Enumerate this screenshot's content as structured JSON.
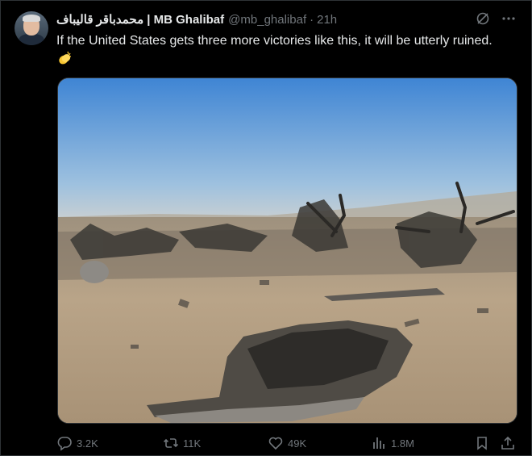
{
  "tweet": {
    "author_name": "محمدباقر قالیباف | MB Ghalibaf",
    "handle": "@mb_ghalibaf",
    "time": "21h",
    "text": "If the United States gets three more victories like this, it will be utterly ruined.",
    "emoji_icon": "clapping-hands-emoji"
  },
  "actions": {
    "replies": "3.2K",
    "reposts": "11K",
    "likes": "49K",
    "views": "1.8M"
  },
  "icons": [
    "grok-icon",
    "more-icon",
    "reply-icon",
    "repost-icon",
    "like-icon",
    "views-icon",
    "bookmark-icon",
    "share-icon"
  ],
  "colors": {
    "background": "#000000",
    "text": "#e7e9ea",
    "secondary": "#71767b",
    "border": "#2f3336"
  }
}
